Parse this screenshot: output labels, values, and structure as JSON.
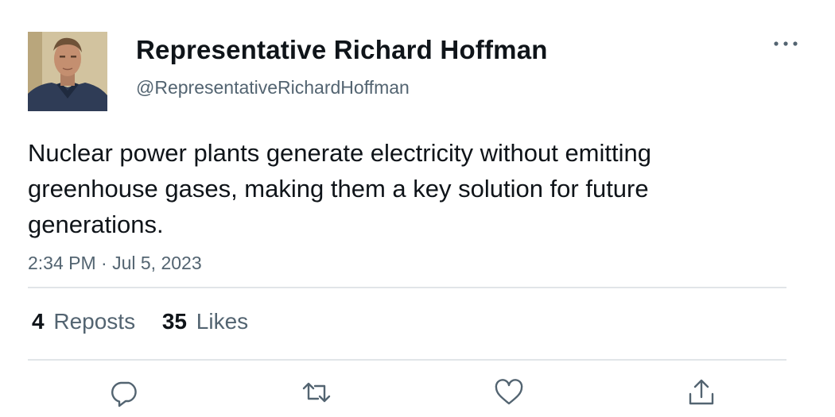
{
  "author": {
    "display_name": "Representative Richard Hoffman",
    "handle": "@RepresentativeRichardHoffman"
  },
  "tweet": {
    "text": "Nuclear power plants generate electricity without emitting greenhouse gases, making them a key solution for future generations.",
    "timestamp": "2:34 PM · Jul 5, 2023"
  },
  "stats": {
    "reposts_count": "4",
    "reposts_label": "Reposts",
    "likes_count": "35",
    "likes_label": "Likes"
  },
  "icons": {
    "more": "more-dots-icon",
    "reply": "reply-icon",
    "repost": "repost-icon",
    "like": "heart-icon",
    "share": "share-icon"
  },
  "colors": {
    "text_primary": "#0f1419",
    "text_secondary": "#536471",
    "divider": "#e1e5e8"
  }
}
